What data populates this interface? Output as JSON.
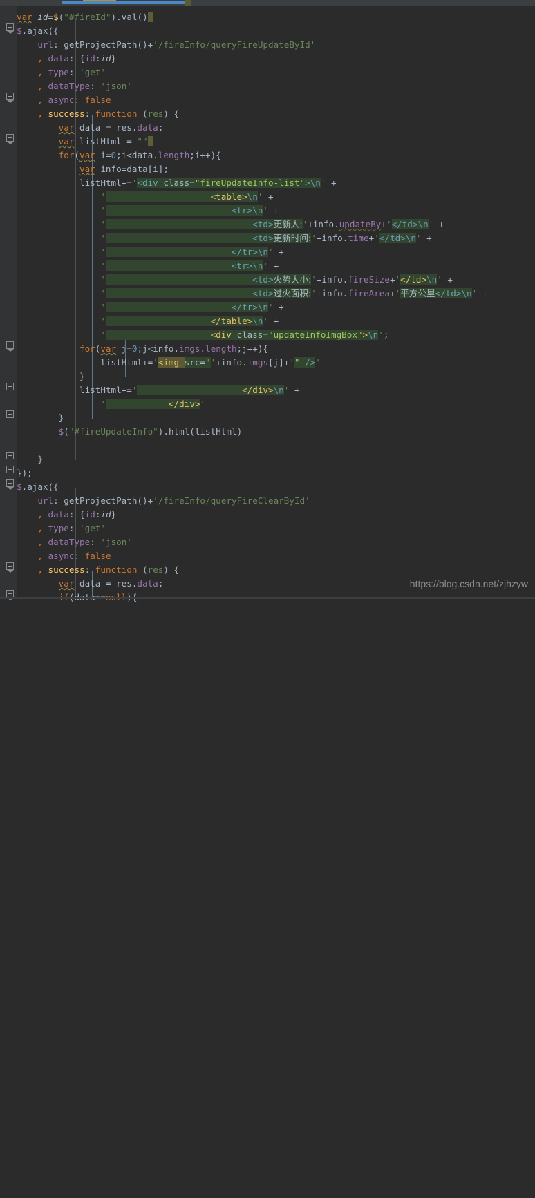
{
  "app": {
    "name": "code-editor",
    "theme": "darcula",
    "background": "#2b2b2b",
    "gutter_background": "#313335",
    "accent": "#4a88c7",
    "string_color": "#6a8759",
    "keyword_color": "#cc7832",
    "field_color": "#9876aa",
    "function_color": "#ffc66d",
    "number_color": "#6897bb"
  },
  "tabstrip": {
    "active_tab_underline_color": "#4a88c7",
    "modified_marker_color": "#b8902f"
  },
  "watermark": {
    "text": "https://blog.csdn.net/zjhzyw"
  },
  "gutter": {
    "fold_markers": [
      {
        "line": 2,
        "state": "open"
      },
      {
        "line": 7,
        "state": "open"
      },
      {
        "line": 10,
        "state": "open"
      },
      {
        "line": 25,
        "state": "open"
      },
      {
        "line": 28,
        "state": "closed"
      },
      {
        "line": 30,
        "state": "closed"
      },
      {
        "line": 31,
        "state": "closed"
      },
      {
        "line": 33,
        "state": "closed"
      },
      {
        "line": 34,
        "state": "open"
      },
      {
        "line": 41,
        "state": "open"
      },
      {
        "line": 43,
        "state": "open"
      }
    ]
  },
  "code": {
    "language": "javascript",
    "caret_line": 1,
    "lines": [
      "var id=$(\"#fireId\").val()",
      "$.ajax({",
      "    url: getProjectPath()+'/fireInfo/queryFireUpdateById'",
      "    , data: {id:id}",
      "    , type: 'get'",
      "    , dataType: 'json'",
      "    , async: false",
      "    , success: function (res) {",
      "        var data = res.data;",
      "        var listHtml = \"\"",
      "        for(var i=0;i<data.length;i++){",
      "            var info=data[i];",
      "            listHtml+='<div class=\"fireUpdateInfo-list\">\\n' +",
      "                '                    <table>\\n' +",
      "                '                        <tr>\\n' +",
      "                '                            <td>更新人:'+info.updateBy+'</td>\\n' +",
      "                '                            <td>更新时间:'+info.time+'</td>\\n' +",
      "                '                        </tr>\\n' +",
      "                '                        <tr>\\n' +",
      "                '                            <td>火势大小:'+info.fireSize+'</td>\\n' +",
      "                '                            <td>过火面积:'+info.fireArea+'平方公里</td>\\n' +",
      "                '                        </tr>\\n' +",
      "                '                    </table>\\n' +",
      "                '                    <div class=\"updateInfoImgBox\">\\n';",
      "            for(var j=0;j<info.imgs.length;j++){",
      "                listHtml+='<img src=\"'+info.imgs[j]+'\" />'",
      "            }",
      "            listHtml+='                    </div>\\n' +",
      "                '            </div>'",
      "        }",
      "        $(\"#fireUpdateInfo\").html(listHtml)",
      "",
      "    }",
      "});",
      "$.ajax({",
      "    url: getProjectPath()+'/fireInfo/queryFireClearById'",
      "    , data: {id:id}",
      "    , type: 'get'",
      "    , dataType: 'json'",
      "    , async: false",
      "    , success: function (res) {",
      "        var data = res.data;",
      "        if(data==null){"
    ]
  }
}
